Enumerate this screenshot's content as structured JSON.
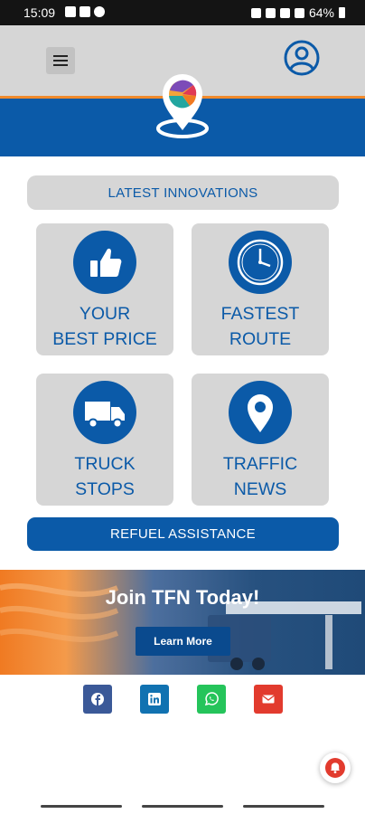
{
  "status_bar": {
    "time": "15:09",
    "battery": "64%",
    "left_icons": [
      "image-icon",
      "linkedin-icon",
      "info-icon"
    ],
    "right_icons": [
      "alarm-icon",
      "mute-icon",
      "wifi-icon",
      "signal-icon",
      "battery-icon"
    ]
  },
  "header": {
    "menu_icon": "hamburger-icon",
    "profile_icon": "user-circle-icon",
    "logo_icon": "location-pin-logo",
    "colors": {
      "header_bg": "#d6d6d6",
      "accent_orange": "#f08a2c",
      "brand_blue": "#0b5aa8"
    }
  },
  "main": {
    "innovations_label": "LATEST INNOVATIONS",
    "cards": [
      {
        "label": "YOUR\nBEST PRICE",
        "icon": "thumbs-up-icon"
      },
      {
        "label": "FASTEST\nROUTE",
        "icon": "clock-icon"
      },
      {
        "label": "TRUCK\nSTOPS",
        "icon": "truck-icon"
      },
      {
        "label": "TRAFFIC\nNEWS",
        "icon": "map-pin-icon"
      }
    ],
    "refuel_label": "REFUEL ASSISTANCE"
  },
  "banner": {
    "title": "Join TFN Today!",
    "button_label": "Learn More"
  },
  "share": [
    {
      "name": "facebook",
      "icon": "facebook-icon",
      "color": "#3b5998"
    },
    {
      "name": "linkedin",
      "icon": "linkedin-icon",
      "color": "#1172b1"
    },
    {
      "name": "whatsapp",
      "icon": "whatsapp-icon",
      "color": "#25c45b"
    },
    {
      "name": "email",
      "icon": "email-icon",
      "color": "#e23b2e"
    }
  ],
  "notification": {
    "icon": "bell-icon",
    "color": "#e23b2e"
  }
}
